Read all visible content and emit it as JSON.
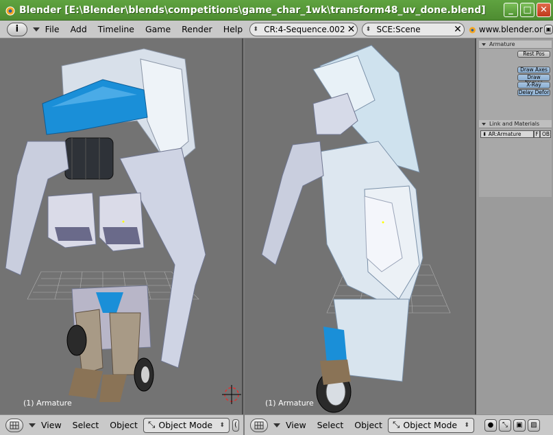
{
  "window": {
    "title": "Blender [E:\\Blender\\blends\\competitions\\game_char_1wk\\transform48_uv_done.blend]",
    "minimize_icon": "minimize-icon",
    "maximize_icon": "maximize-icon",
    "close_icon": "close-icon"
  },
  "menubar": {
    "info_label": "i",
    "items": [
      "File",
      "Add",
      "Timeline",
      "Game",
      "Render",
      "Help"
    ],
    "screen_field": "CR:4-Sequence.002",
    "scene_field": "SCE:Scene",
    "url": "www.blender.or"
  },
  "viewports": {
    "left_label": "(1) Armature",
    "right_label": "(1) Armature"
  },
  "buttons_panel": {
    "armature_header": "Armature",
    "rest_pos": "Rest Pos",
    "draw_axes": "Draw Axes",
    "draw_names": "Draw Names",
    "x_ray": "X-Ray",
    "delay_deform": "Delay Defor",
    "link_header": "Link and Materials",
    "ar_field": "AR:Armature",
    "f_label": "F",
    "ob_label": "OB:"
  },
  "bottom_header_left": {
    "view": "View",
    "select": "Select",
    "object": "Object",
    "mode": "Object Mode"
  },
  "bottom_header_right": {
    "view": "View",
    "select": "Select",
    "object": "Object",
    "mode": "Object Mode"
  },
  "colors": {
    "title_green": "#4e8c31",
    "header_gray": "#c9c9c9",
    "viewport_gray": "#737373",
    "robot_blue": "#1a8fd8"
  }
}
